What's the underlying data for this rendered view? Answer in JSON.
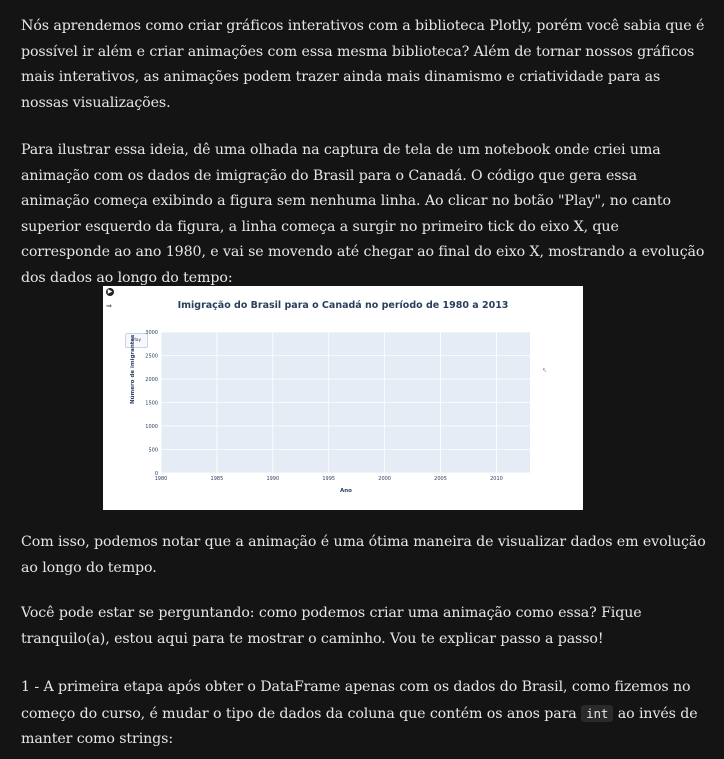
{
  "paragraphs": {
    "p1": "Nós aprendemos como criar gráficos interativos com a biblioteca Plotly, porém você sabia que é possível ir além e criar animações com essa mesma biblioteca? Além de tornar nossos gráficos mais interativos, as animações podem trazer ainda mais dinamismo e criatividade para as nossas visualizações.",
    "p2": "Para ilustrar essa ideia, dê uma olhada na captura de tela de um notebook onde criei uma animação com os dados de imigração do Brasil para o Canadá. O código que gera essa animação começa exibindo a figura sem nenhuma linha. Ao clicar no botão \"Play\", no canto superior esquerdo da figura, a linha começa a surgir no primeiro tick do eixo X, que corresponde ao ano 1980, e vai se movendo até chegar ao final do eixo X, mostrando a evolução dos dados ao longo do tempo:",
    "p3": "Com isso, podemos notar que a animação é uma ótima maneira de visualizar dados em evolução ao longo do tempo.",
    "p4": "Você pode estar se perguntando: como podemos criar uma animação como essa? Fique tranquilo(a), estou aqui para te mostrar o caminho. Vou te explicar passo a passo!",
    "p5_before": "1 - A primeira etapa após obter o DataFrame apenas com os dados do Brasil, como fizemos no começo do curso, é mudar o tipo de dados da coluna que contém os anos para ",
    "p5_code": "int",
    "p5_after": " ao invés de manter como strings:"
  },
  "figure": {
    "run_icon": "play-circle-icon",
    "output_icon": "output-arrow-icon",
    "play_label": "Play",
    "cursor_icon": "pointer-cursor-icon",
    "colors": {
      "plot_bg": "#e5ecf6",
      "grid": "#ffffff",
      "text": "#2a3f5f"
    }
  },
  "chart_data": {
    "type": "line",
    "title": "Imigração do Brasil para o Canadá no período de 1980 a 2013",
    "xlabel": "Ano",
    "ylabel": "Número de imigrantes",
    "x_ticks": [
      1980,
      1985,
      1990,
      1995,
      2000,
      2005,
      2010
    ],
    "y_ticks": [
      0,
      500,
      1000,
      1500,
      2000,
      2500,
      3000
    ],
    "xlim": [
      1980,
      2013
    ],
    "ylim": [
      0,
      3000
    ],
    "grid": true,
    "series": []
  }
}
